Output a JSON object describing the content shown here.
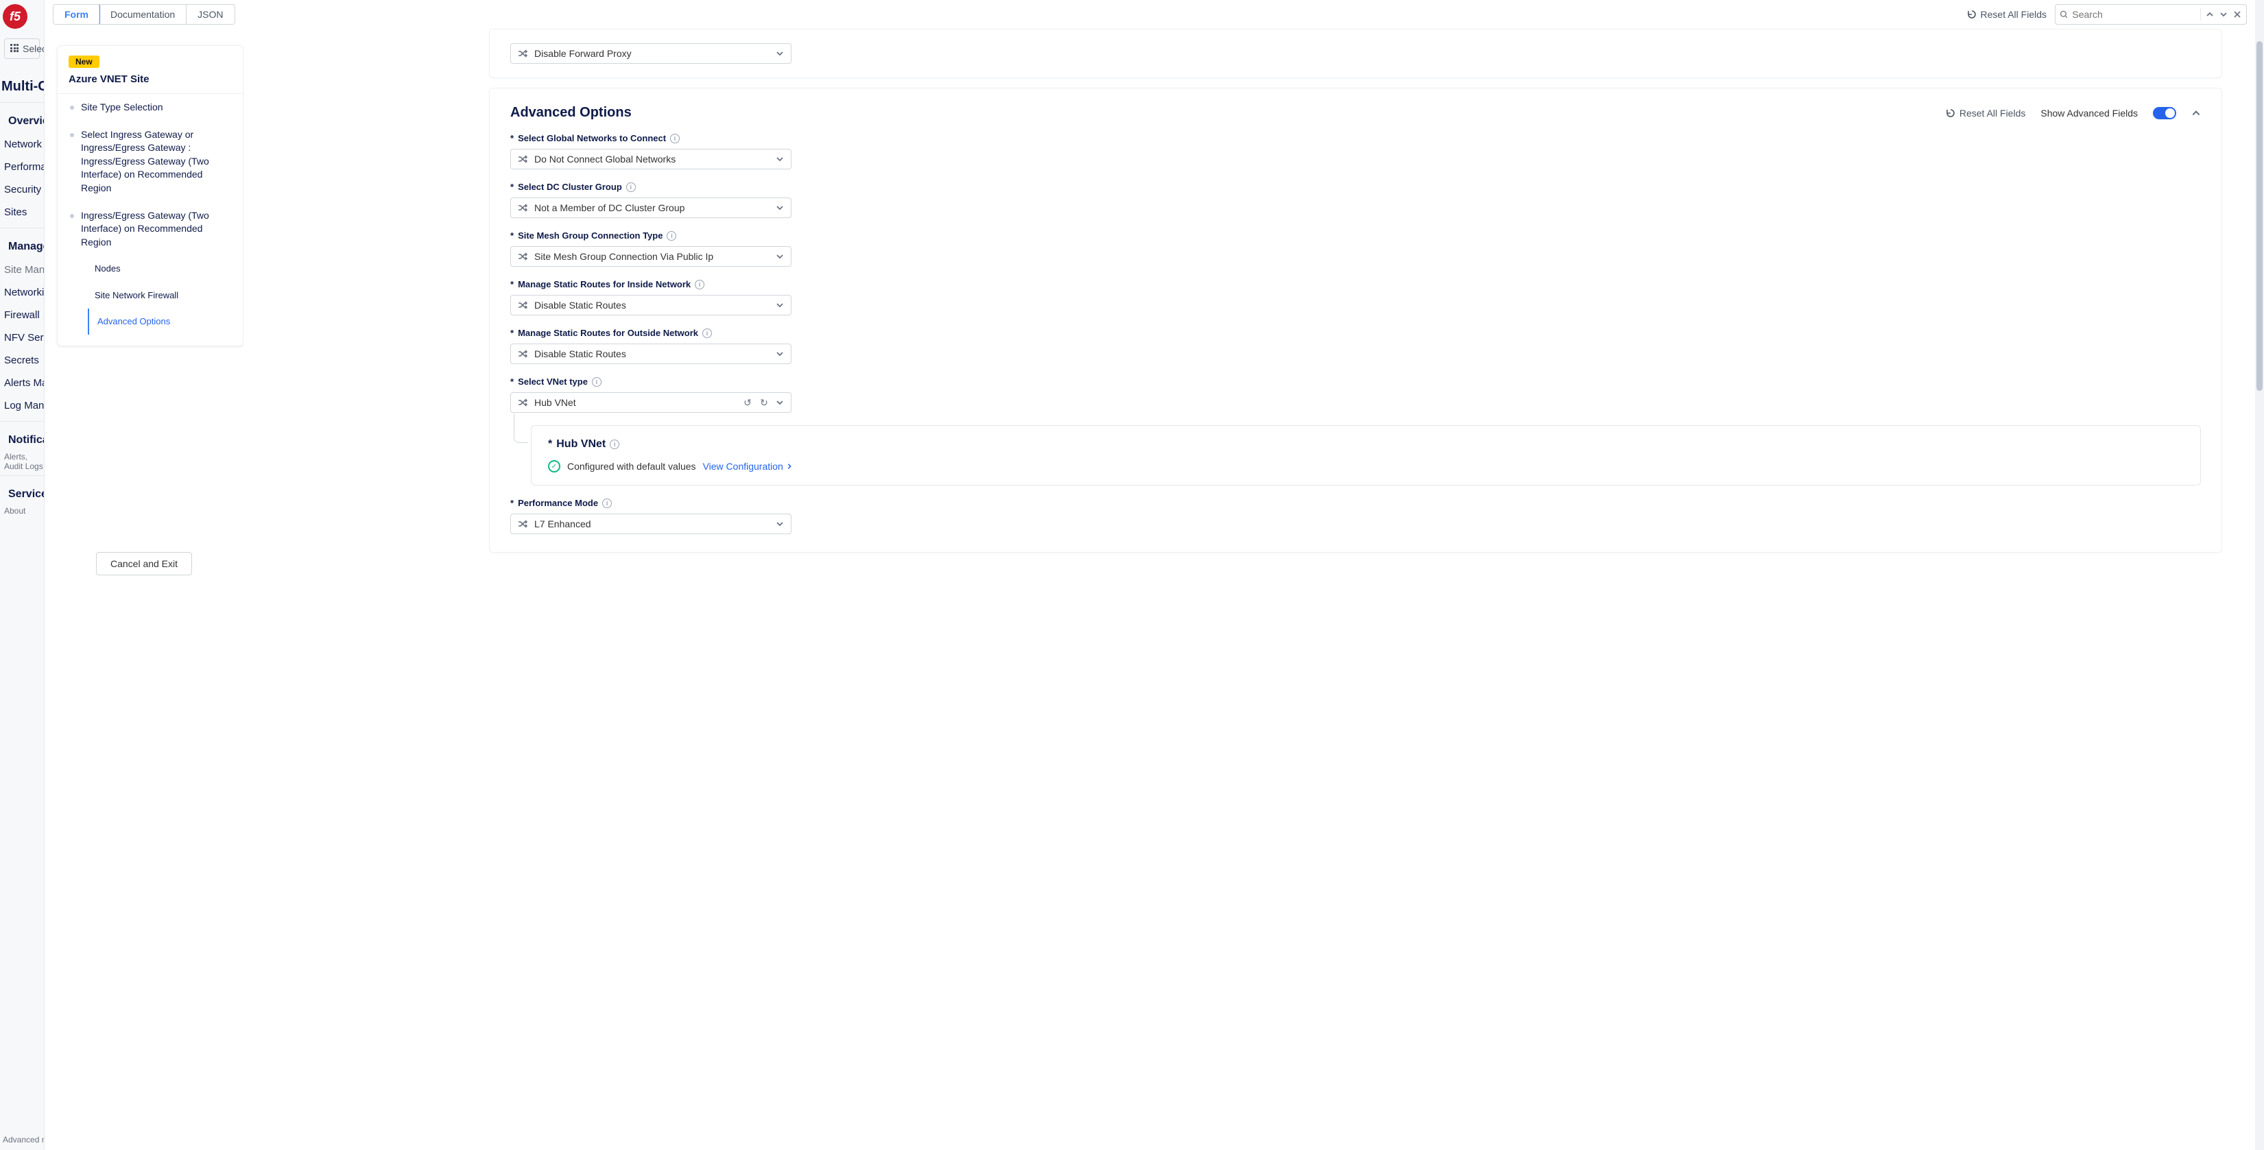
{
  "app_sidebar": {
    "logo_text": "f5",
    "select_service": "Select",
    "product_title": "Multi-Cloud Network Connect",
    "groups": {
      "overview": {
        "label": "Overview",
        "items": [
          "Network",
          "Performance",
          "Security",
          "Sites"
        ]
      },
      "manage": {
        "label": "Manage",
        "items": [
          "Site Management",
          "Networking",
          "Firewall",
          "NFV Services",
          "Secrets",
          "Alerts Management",
          "Log Management"
        ]
      },
      "notifications": {
        "label": "Notifications",
        "sub": "Alerts, Audit Logs"
      },
      "services": {
        "label": "Services",
        "sub": "About"
      }
    },
    "advanced_footer": "Advanced nav"
  },
  "topbar": {
    "tabs": {
      "form": "Form",
      "documentation": "Documentation",
      "json": "JSON"
    },
    "reset_all": "Reset All Fields",
    "search_placeholder": "Search"
  },
  "outline": {
    "badge": "New",
    "title": "Azure VNET Site",
    "items": {
      "site_type": "Site Type Selection",
      "ingress_sel": "Select Ingress Gateway or Ingress/Egress Gateway : Ingress/Egress Gateway (Two Interface) on Recommended Region",
      "ingress_egress": "Ingress/Egress Gateway (Two Interface) on Recommended Region",
      "nodes": "Nodes",
      "site_fw": "Site Network Firewall",
      "adv_options": "Advanced Options"
    },
    "cancel_exit": "Cancel and Exit"
  },
  "form": {
    "top_select": {
      "value": "Disable Forward Proxy"
    },
    "advanced_options": {
      "title": "Advanced Options",
      "reset": "Reset All Fields",
      "show_advanced": "Show Advanced Fields",
      "fields": {
        "global_networks": {
          "label": "Select Global Networks to Connect",
          "value": "Do Not Connect Global Networks"
        },
        "dc_cluster": {
          "label": "Select DC Cluster Group",
          "value": "Not a Member of DC Cluster Group"
        },
        "site_mesh": {
          "label": "Site Mesh Group Connection Type",
          "value": "Site Mesh Group Connection Via Public Ip"
        },
        "static_in": {
          "label": "Manage Static Routes for Inside Network",
          "value": "Disable Static Routes"
        },
        "static_out": {
          "label": "Manage Static Routes for Outside Network",
          "value": "Disable Static Routes"
        },
        "vnet_type": {
          "label": "Select VNet type",
          "value": "Hub VNet"
        },
        "hub_vnet_card": {
          "title": "Hub VNet",
          "status": "Configured with default values",
          "view_link": "View Configuration"
        },
        "perf_mode": {
          "label": "Performance Mode",
          "value": "L7 Enhanced"
        }
      }
    }
  }
}
